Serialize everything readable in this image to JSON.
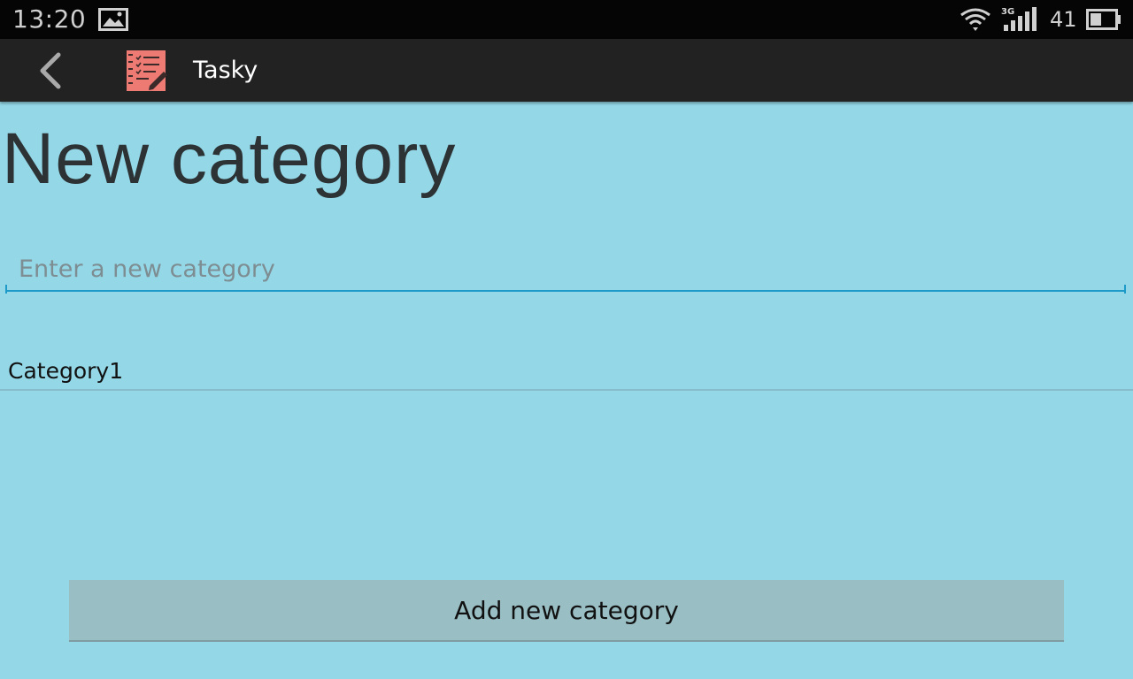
{
  "status_bar": {
    "time": "13:20",
    "network_type": "3G",
    "battery_percent": "41",
    "icons": [
      "image-notification-icon",
      "wifi-icon",
      "signal-icon",
      "battery-icon"
    ]
  },
  "action_bar": {
    "title": "Tasky",
    "back_icon": "chevron-left-icon",
    "app_icon": "checklist-notebook-icon"
  },
  "page": {
    "title": "New category"
  },
  "category_input": {
    "value": "",
    "placeholder": "Enter a new category"
  },
  "categories": [
    {
      "label": "Category1"
    }
  ],
  "add_button": {
    "label": "Add new category"
  },
  "colors": {
    "background": "#94d8e8",
    "status_bar": "#050505",
    "action_bar": "#222222",
    "input_accent": "#1e9ac9",
    "button": "#99bfc5",
    "app_icon": "#ee7b73"
  }
}
